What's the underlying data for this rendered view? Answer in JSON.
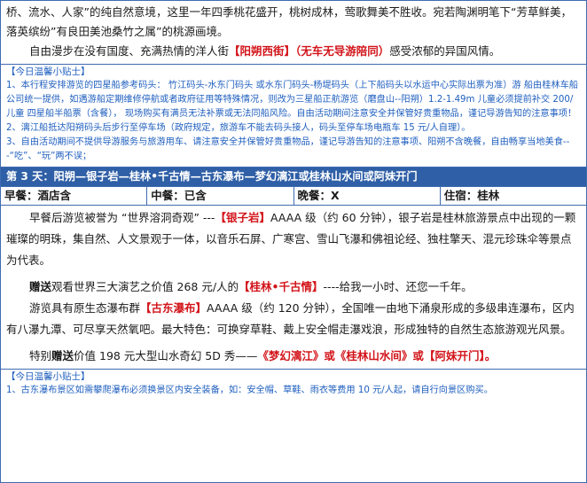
{
  "intro": {
    "line1": "桥、流水、人家”的纯自然意境，这里一年四季桃花盛开，桃树成林，莺歌舞美不胜收。宛若陶渊明笔下“芳草鲜美，落英缤纷”有良田美池桑竹之属”的桃源画境。",
    "line2_pre": "自由漫步在没有国度、充满热情的洋人街",
    "line2_hl": "【阳朔西街】（无车无导游陪同）",
    "line2_post": "感受浓郁的异国风情。"
  },
  "tips1": {
    "title": "【今日温馨小贴士】",
    "items": [
      "1、本行程安排游览的四星船参考码头： 竹江码头-水东门码头 或水东门码头-杨堤码头（上下船码头以水运中心实际出票为准）游 船由桂林车船公司统一提供，如遇游船定期维修停航或者政府征用等特殊情况，则改为三星船正航游览（磨盘山--阳朔）1.2-1.49m 儿童必须提前补交 200/儿童 四星船半船票（含餐）， 现场购买有满员无法补票或无法同船风险。自由活动期间注意安全并保管好贵重物品，谨记导游告知的注意事项！",
      "2、漓江船抵达阳朔码头后步行至停车场（政府规定，旅游车不能去码头接人，码头至停车场电瓶车 15 元/人自理）。",
      "3、自由活动期间不提供导游服务与旅游用车、请注意安全并保管好贵重物品，谨记导游告知的注意事项、阳朔不含晚餐，自由畅享当地美食---“吃”、“玩”两不误；"
    ]
  },
  "day3": {
    "header": "第 3 天：阳朔—银子岩—桂林•千古情—古东瀑布—梦幻漓江或桂林山水间或阿妹开门",
    "meals": [
      {
        "label": "早餐：",
        "value": "酒店含"
      },
      {
        "label": "中餐：",
        "value": "已含"
      },
      {
        "label": "晚餐：",
        "value": "X"
      },
      {
        "label": "住宿：",
        "value": "桂林"
      }
    ],
    "para1_pre": "早餐后游览被誉为 “世界溶洞奇观” ---",
    "para1_hl": "【银子岩】",
    "para1_post": "AAAA 级（约 60 分钟），银子岩是桂林旅游景点中出现的一颗璀璨的明珠，集自然、人文景观于一体，以音乐石屏、广寒宫、雪山飞瀑和佛祖论经、独柱擎天、混元珍珠伞等景点为代表。",
    "para2_bold": "赠送",
    "para2_pre": "观看世界三大演艺之价值 268 元/人的",
    "para2_hl": "【桂林•千古情】",
    "para2_post": "----给我一小时、还您一千年。",
    "para3_pre": "游览具有原生态瀑布群",
    "para3_hl": "【古东瀑布】",
    "para3_post": "AAAA 级（约 120 分钟），全国唯一由地下涌泉形成的多级串连瀑布，区内有八瀑九潭、可尽享天然氧吧。最大特色：可换穿草鞋、戴上安全帽走瀑戏浪，形成独特的自然生态旅游观光风景。",
    "para4_pre": "特别",
    "para4_bold": "赠送",
    "para4_mid": "价值 198 元大型山水奇幻 5D 秀——",
    "para4_hl1": "《梦幻漓江》",
    "para4_or1": "或",
    "para4_hl2": "《桂林山水间》",
    "para4_or2": "或",
    "para4_hl3": "【阿妹开门】",
    "para4_end": "。"
  },
  "tips2": {
    "title": "【今日温馨小贴士】",
    "item1": "1、古东瀑布景区如需攀爬瀑布必须换景区内安全装备，如：安全帽、草鞋、雨衣等费用 10 元/人起，请自行向景区购买。"
  }
}
